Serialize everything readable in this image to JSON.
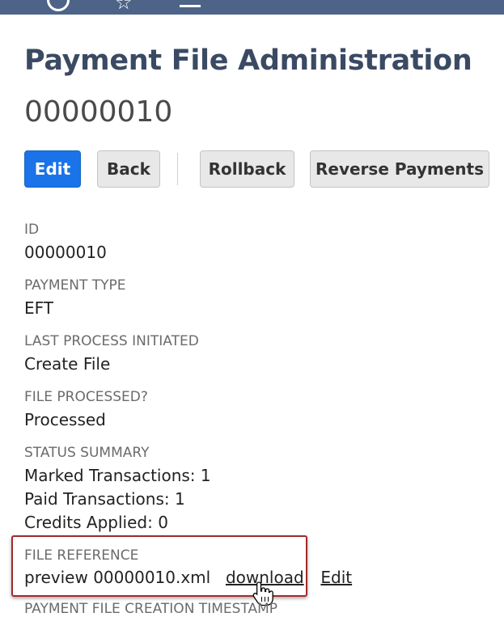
{
  "header": {
    "title": "Payment File Administration",
    "record_number": "00000010"
  },
  "toolbar": {
    "edit_label": "Edit",
    "back_label": "Back",
    "rollback_label": "Rollback",
    "reverse_label": "Reverse Payments"
  },
  "fields": {
    "id": {
      "label": "ID",
      "value": "00000010"
    },
    "payment_type": {
      "label": "PAYMENT TYPE",
      "value": "EFT"
    },
    "last_process": {
      "label": "LAST PROCESS INITIATED",
      "value": "Create File"
    },
    "file_processed": {
      "label": "FILE PROCESSED?",
      "value": "Processed"
    },
    "status_summary": {
      "label": "STATUS SUMMARY",
      "lines": [
        "Marked Transactions: 1",
        "Paid Transactions: 1",
        "Credits Applied: 0"
      ]
    },
    "file_reference": {
      "label": "FILE REFERENCE",
      "file_name": "preview 00000010.xml",
      "download_label": "download",
      "edit_label": "Edit"
    },
    "creation_timestamp": {
      "label": "PAYMENT FILE CREATION TIMESTAMP"
    }
  },
  "colors": {
    "topbar": "#4d6488",
    "primary_button": "#1a73e8",
    "title": "#3b4a63",
    "highlight_border": "#a32a2a"
  },
  "icons": [
    "circle-icon",
    "star-icon",
    "dash-icon",
    "hand-cursor-icon"
  ]
}
